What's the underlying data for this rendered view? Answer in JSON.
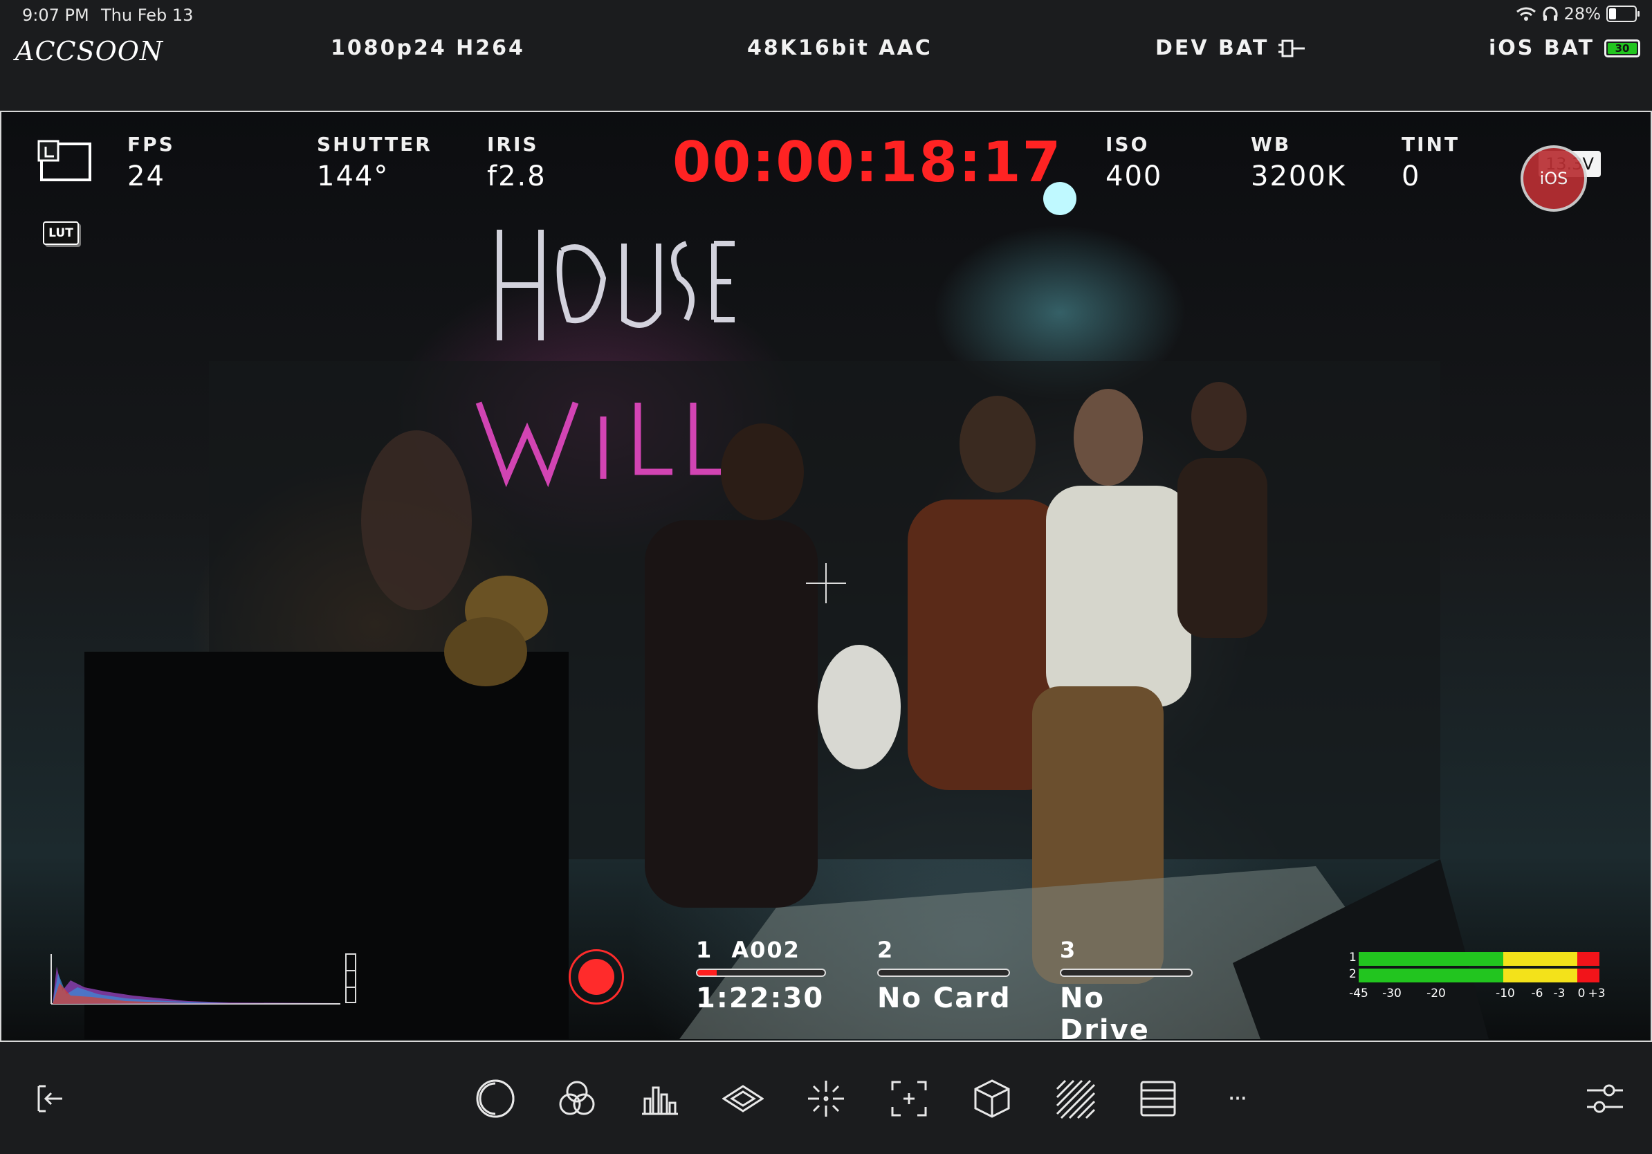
{
  "status_bar": {
    "time": "9:07 PM",
    "date": "Thu Feb 13",
    "battery_percent": "28%",
    "battery_level": 0.28
  },
  "header": {
    "brand": "ACCSOON",
    "video_format": "1080p24 H264",
    "audio_format": "48K16bit AAC",
    "dev_bat_label": "DEV BAT",
    "ios_bat_label": "iOS BAT",
    "ios_bat_value": "30"
  },
  "hud": {
    "fps": {
      "label": "FPS",
      "value": "24"
    },
    "shutter": {
      "label": "SHUTTER",
      "value": "144°"
    },
    "iris": {
      "label": "IRIS",
      "value": "f2.8"
    },
    "timecode": "00:00:18:17",
    "iso": {
      "label": "ISO",
      "value": "400"
    },
    "wb": {
      "label": "WB",
      "value": "3200K"
    },
    "tint": {
      "label": "TINT",
      "value": "0"
    },
    "lut_badge": "LUT",
    "voltage": "13.3V",
    "ios_record_label": "iOS"
  },
  "media": [
    {
      "slot": "1",
      "clip": "A002",
      "value": "1:22:30",
      "fill": 0.15
    },
    {
      "slot": "2",
      "clip": "",
      "value": "No Card",
      "fill": 0
    },
    {
      "slot": "3",
      "clip": "",
      "value": "No Drive",
      "fill": 0
    }
  ],
  "audio_meter": {
    "channels": [
      "1",
      "2"
    ],
    "scale": [
      "-45",
      "-30",
      "-20",
      "-10",
      "-6",
      "-3",
      "0",
      "+3"
    ],
    "colors": {
      "green": "#22c51f",
      "yellow": "#f3e21a",
      "red": "#f2141a"
    }
  },
  "toolbar": {
    "icons": [
      "exit-icon",
      "zebra-contrast-icon",
      "color-channels-icon",
      "histogram-icon",
      "waveform-icon",
      "focus-peaking-icon",
      "frame-guide-icon",
      "lut-cube-icon",
      "zebra-stripes-icon",
      "frame-lines-icon",
      "more-icon",
      "settings-sliders-icon"
    ],
    "more_label": "···"
  },
  "colors": {
    "accent_red": "#ff2323",
    "background": "#1b1c1e"
  }
}
